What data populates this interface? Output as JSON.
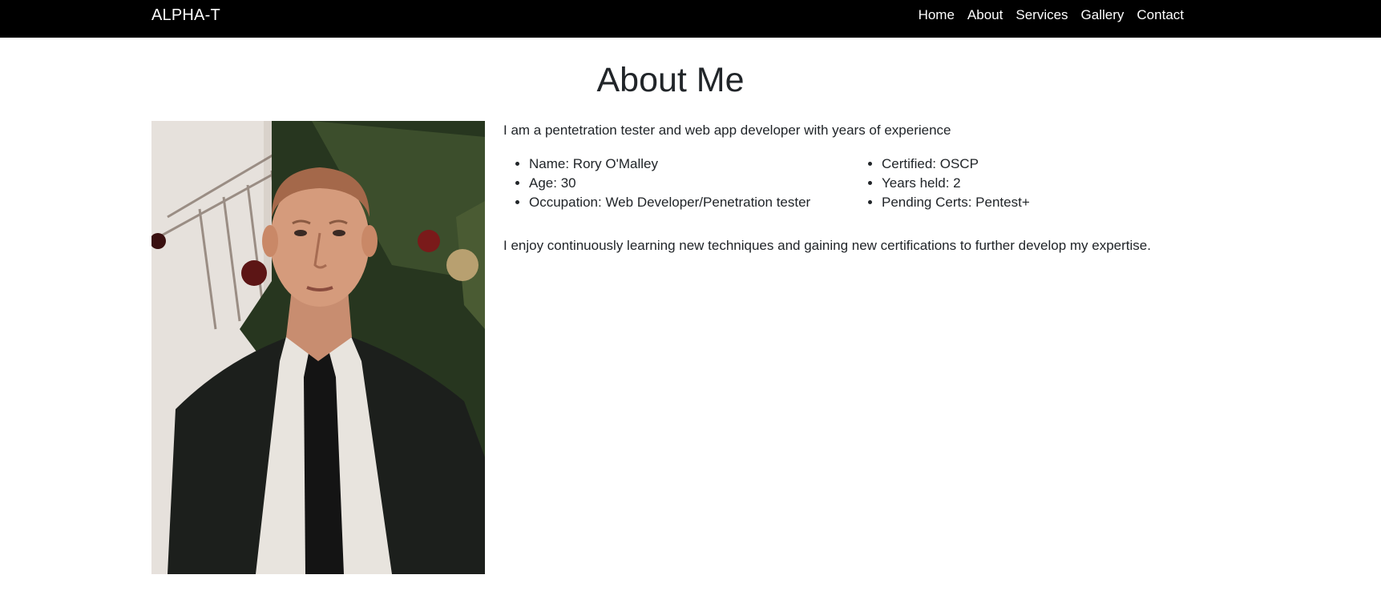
{
  "navbar": {
    "brand": "ALPHA-T",
    "links": [
      "Home",
      "About",
      "Services",
      "Gallery",
      "Contact"
    ],
    "background": "#000000",
    "text_color": "#ffffff"
  },
  "main": {
    "title": "About Me",
    "photo_icon": "profile-photo",
    "intro": "I am a pentetration tester and web app developer with years of experience",
    "details_left": [
      "Name: Rory O'Malley",
      "Age: 30",
      "Occupation: Web Developer/Penetration tester"
    ],
    "details_right": [
      "Certified: OSCP",
      "Years held: 2",
      "Pending Certs: Pentest+"
    ],
    "outro": "I enjoy continuously learning new techniques and gaining new certifications to further develop my expertise."
  }
}
